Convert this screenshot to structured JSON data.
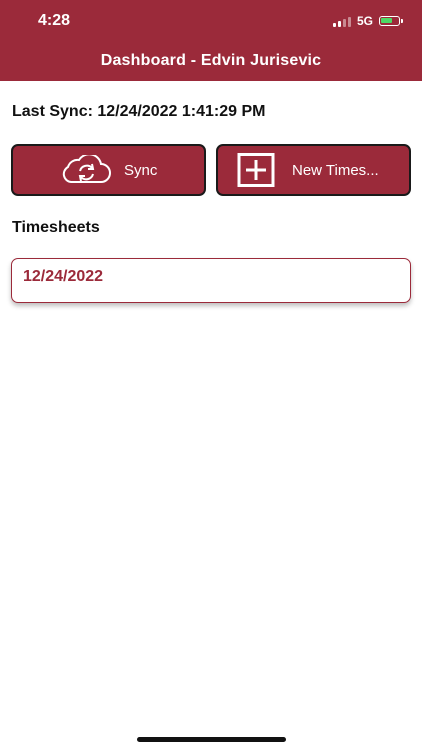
{
  "status_bar": {
    "time": "4:28",
    "network": "5G",
    "battery_color": "#4cd964"
  },
  "header": {
    "title": "Dashboard - Edvin Jurisevic",
    "background_color": "#9b2a3a"
  },
  "last_sync": {
    "text": "Last Sync: 12/24/2022 1:41:29 PM"
  },
  "actions": {
    "sync": {
      "label": "Sync",
      "icon": "cloud-sync-icon"
    },
    "new_timesheet": {
      "label": "New Times...",
      "icon": "plus-box-icon"
    }
  },
  "timesheets": {
    "section_title": "Timesheets",
    "items": [
      {
        "date": "12/24/2022"
      }
    ]
  },
  "colors": {
    "accent": "#9b2a3a",
    "text": "#111111"
  }
}
